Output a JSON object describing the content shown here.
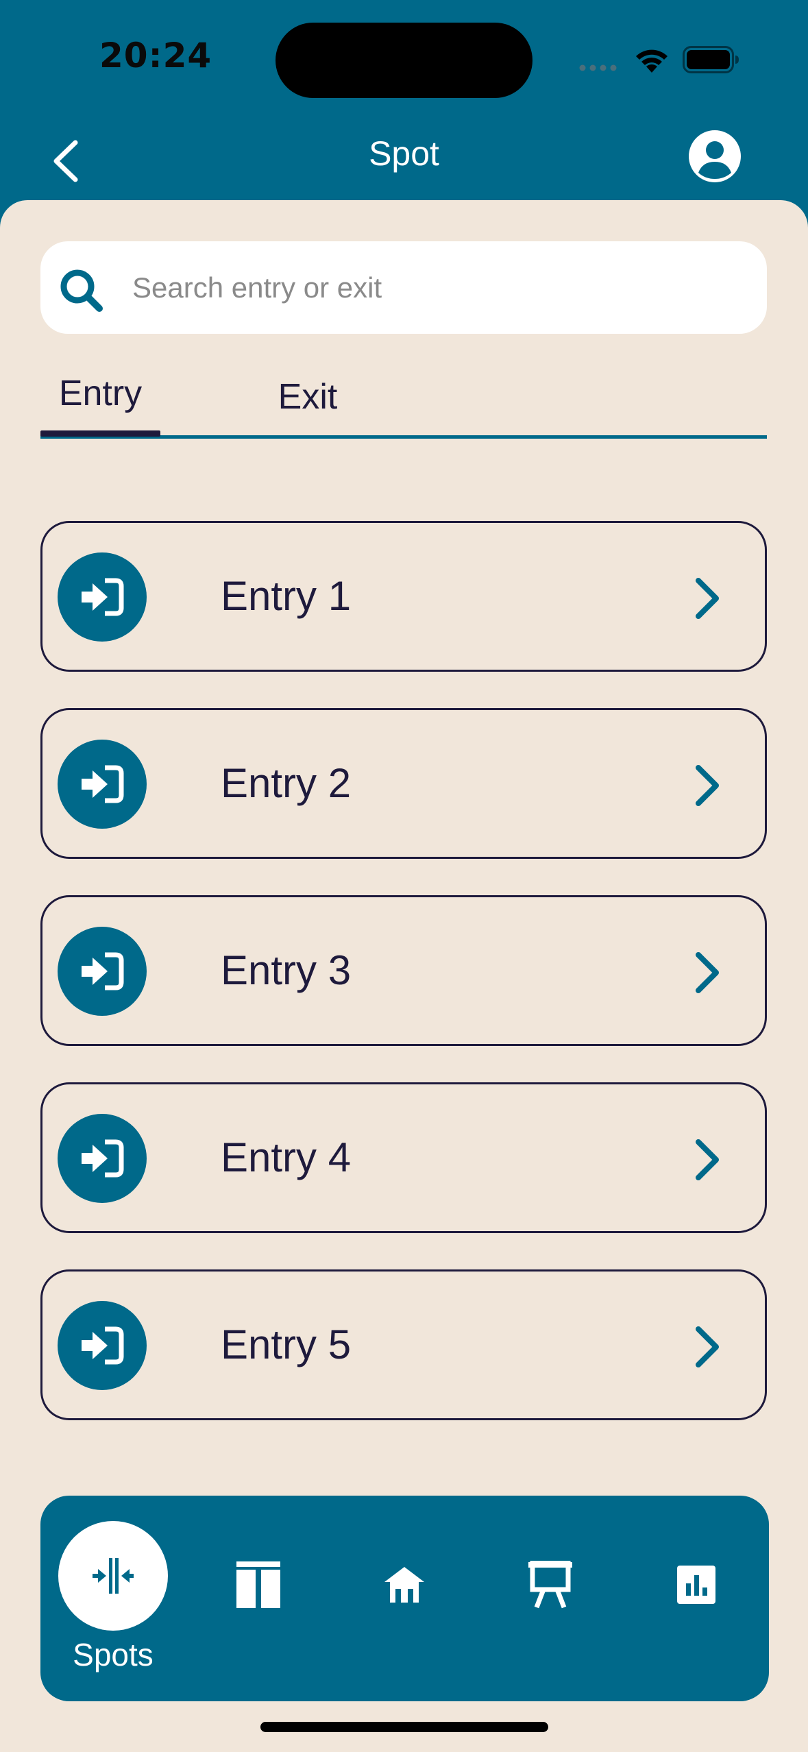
{
  "status_bar": {
    "time": "20:24"
  },
  "header": {
    "title": "Spot",
    "back_icon": "chevron-left-icon",
    "profile_icon": "user-circle-icon"
  },
  "search": {
    "placeholder": "Search entry or exit",
    "value": ""
  },
  "tabs": [
    {
      "label": "Entry",
      "active": true
    },
    {
      "label": "Exit",
      "active": false
    }
  ],
  "entries": [
    {
      "label": "Entry 1",
      "icon": "sign-in-icon"
    },
    {
      "label": "Entry 2",
      "icon": "sign-in-icon"
    },
    {
      "label": "Entry 3",
      "icon": "sign-in-icon"
    },
    {
      "label": "Entry 4",
      "icon": "sign-in-icon"
    },
    {
      "label": "Entry 5",
      "icon": "sign-in-icon"
    }
  ],
  "bottom_nav": {
    "active_label": "Spots",
    "items": [
      {
        "icon": "spots-icon",
        "label": "Spots",
        "active": true
      },
      {
        "icon": "columns-icon",
        "active": false
      },
      {
        "icon": "house-icon",
        "active": false
      },
      {
        "icon": "presentation-icon",
        "active": false
      },
      {
        "icon": "chart-bar-icon",
        "active": false
      }
    ]
  },
  "colors": {
    "primary": "#00698a",
    "background": "#f1e6da",
    "text": "#1e1a3c",
    "white": "#ffffff"
  }
}
